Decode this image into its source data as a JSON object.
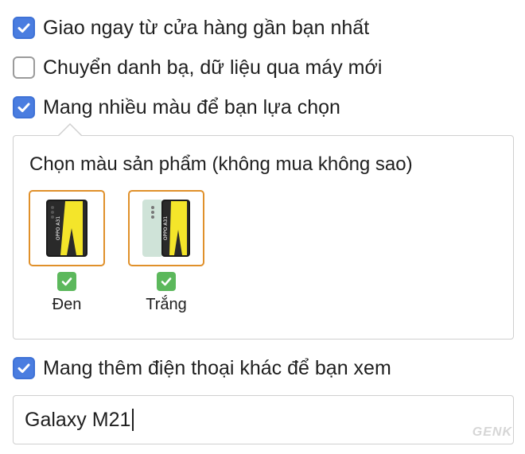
{
  "options": [
    {
      "label": "Giao ngay từ cửa hàng gần bạn nhất",
      "checked": true
    },
    {
      "label": "Chuyển danh bạ, dữ liệu qua máy mới",
      "checked": false
    },
    {
      "label": "Mang nhiều màu để bạn lựa chọn",
      "checked": true
    },
    {
      "label": "Mang thêm điện thoại khác để bạn xem",
      "checked": true
    }
  ],
  "color_panel": {
    "title": "Chọn màu sản phẩm (không mua không sao)",
    "swatches": [
      {
        "label": "Đen",
        "selected": true,
        "phone_label": "OPPO A31",
        "phone_color": "#1b1b1b"
      },
      {
        "label": "Trắng",
        "selected": true,
        "phone_label": "OPPO A31",
        "phone_color": "#cfe3d8"
      }
    ]
  },
  "other_phone_input": {
    "value": "Galaxy M21"
  },
  "watermark": "GENK",
  "colors": {
    "checkbox_blue": "#4a7de0",
    "selection_orange": "#e0902a",
    "check_green": "#5cb85c",
    "accent_yellow": "#f4e52a"
  }
}
